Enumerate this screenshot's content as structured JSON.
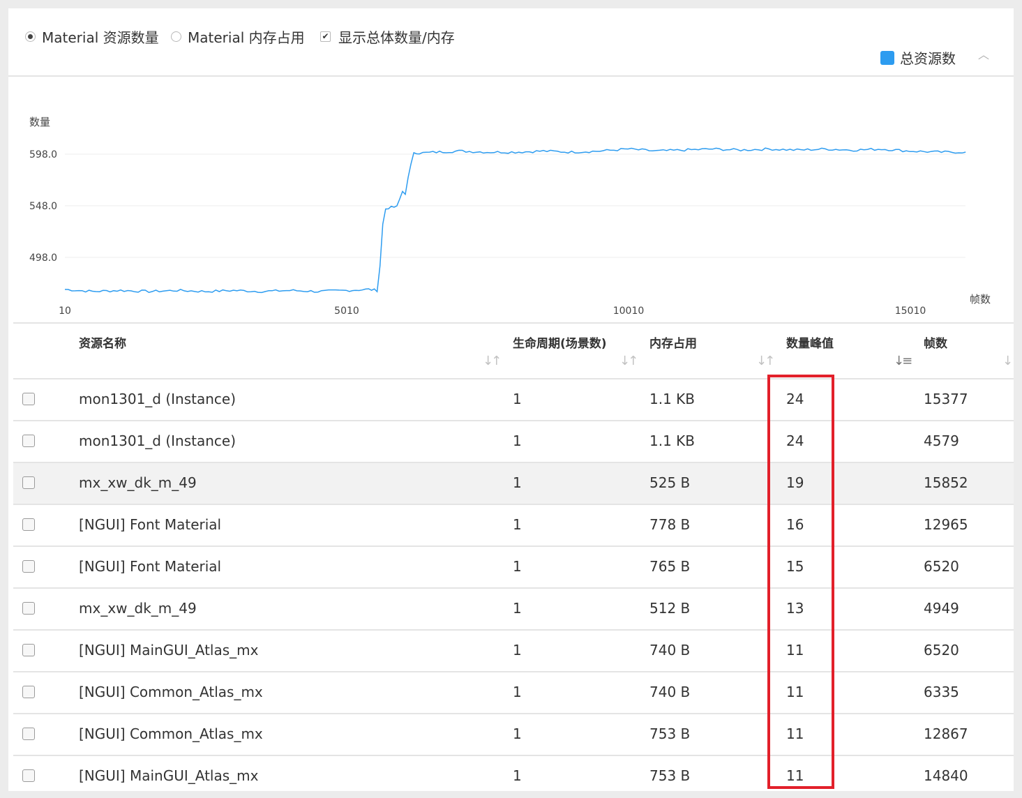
{
  "toolbar": {
    "options": [
      {
        "label": "Material 资源数量",
        "type": "radio",
        "checked": true
      },
      {
        "label": "Material 内存占用",
        "type": "radio",
        "checked": false
      },
      {
        "label": "显示总体数量/内存",
        "type": "checkbox",
        "checked": true
      }
    ],
    "legend_label": "总资源数",
    "legend_color": "#2d9cf0",
    "collapse_icon": "chevron-up-icon"
  },
  "chart_data": {
    "type": "line",
    "ylabel": "数量",
    "xlabel": "帧数",
    "y_ticks": [
      "598.0",
      "548.0",
      "498.0"
    ],
    "x_ticks": [
      "10",
      "5010",
      "10010",
      "15010"
    ],
    "ylim": [
      466,
      610
    ],
    "xlim": [
      10,
      15990
    ],
    "grid": true,
    "series": [
      {
        "name": "总资源数",
        "color": "#2d9cf0",
        "x": [
          10,
          500,
          1000,
          1500,
          2000,
          2500,
          3000,
          3500,
          4000,
          4500,
          5000,
          5400,
          5550,
          5600,
          5650,
          5700,
          5750,
          5900,
          6000,
          6050,
          6100,
          6200,
          6300,
          6600,
          7000,
          7500,
          8000,
          8500,
          9000,
          9500,
          10000,
          10500,
          11000,
          11500,
          12000,
          12500,
          13000,
          13500,
          14000,
          14500,
          15000,
          15500,
          15990
        ],
        "y": [
          467,
          465,
          466,
          465,
          466,
          465,
          466,
          465,
          466,
          465,
          466,
          467,
          466,
          490,
          530,
          545,
          546,
          547,
          562,
          560,
          575,
          600,
          599,
          600,
          601,
          600,
          600,
          601,
          600,
          601,
          603,
          601,
          602,
          603,
          602,
          603,
          602,
          603,
          602,
          603,
          601,
          600,
          600
        ]
      }
    ]
  },
  "table": {
    "headers": [
      "资源名称",
      "生命周期(场景数)",
      "内存占用",
      "数量峰值",
      "帧数"
    ],
    "sort_icon": "sort-icon",
    "rows": [
      {
        "name": "mon1301_d (Instance)",
        "life": "1",
        "mem": "1.1 KB",
        "peak": "24",
        "frames": "15377"
      },
      {
        "name": "mon1301_d (Instance)",
        "life": "1",
        "mem": "1.1 KB",
        "peak": "24",
        "frames": "4579"
      },
      {
        "name": "mx_xw_dk_m_49",
        "life": "1",
        "mem": "525 B",
        "peak": "19",
        "frames": "15852"
      },
      {
        "name": "[NGUI] Font Material",
        "life": "1",
        "mem": "778 B",
        "peak": "16",
        "frames": "12965"
      },
      {
        "name": "[NGUI] Font Material",
        "life": "1",
        "mem": "765 B",
        "peak": "15",
        "frames": "6520"
      },
      {
        "name": "mx_xw_dk_m_49",
        "life": "1",
        "mem": "512 B",
        "peak": "13",
        "frames": "4949"
      },
      {
        "name": "[NGUI] MainGUI_Atlas_mx",
        "life": "1",
        "mem": "740 B",
        "peak": "11",
        "frames": "6520"
      },
      {
        "name": "[NGUI] Common_Atlas_mx",
        "life": "1",
        "mem": "740 B",
        "peak": "11",
        "frames": "6335"
      },
      {
        "name": "[NGUI] Common_Atlas_mx",
        "life": "1",
        "mem": "753 B",
        "peak": "11",
        "frames": "12867"
      },
      {
        "name": "[NGUI] MainGUI_Atlas_mx",
        "life": "1",
        "mem": "753 B",
        "peak": "11",
        "frames": "14840"
      }
    ],
    "highlight_color": "#e2202a"
  }
}
